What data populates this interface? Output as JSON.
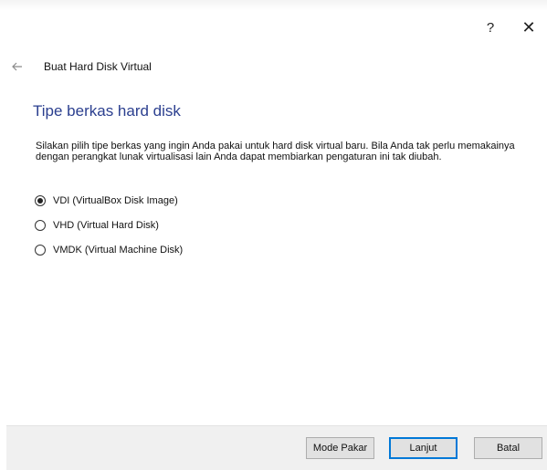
{
  "window": {
    "help_label": "?",
    "close_label": "✕"
  },
  "nav": {
    "back_icon": "arrow-left-icon",
    "title": "Buat Hard Disk Virtual"
  },
  "page": {
    "heading": "Tipe berkas hard disk",
    "description": "Silakan pilih tipe berkas yang ingin Anda pakai untuk hard disk virtual baru. Bila Anda tak perlu memakainya dengan perangkat lunak virtualisasi lain Anda dapat membiarkan pengaturan ini tak diubah."
  },
  "options": [
    {
      "label": "VDI (VirtualBox Disk Image)",
      "selected": true
    },
    {
      "label": "VHD (Virtual Hard Disk)",
      "selected": false
    },
    {
      "label": "VMDK (Virtual Machine Disk)",
      "selected": false
    }
  ],
  "footer": {
    "expert_label": "Mode Pakar",
    "next_label": "Lanjut",
    "cancel_label": "Batal"
  },
  "colors": {
    "heading": "#2b3f8f",
    "focus_border": "#0078d7",
    "footer_bg": "#f0f0f0"
  }
}
